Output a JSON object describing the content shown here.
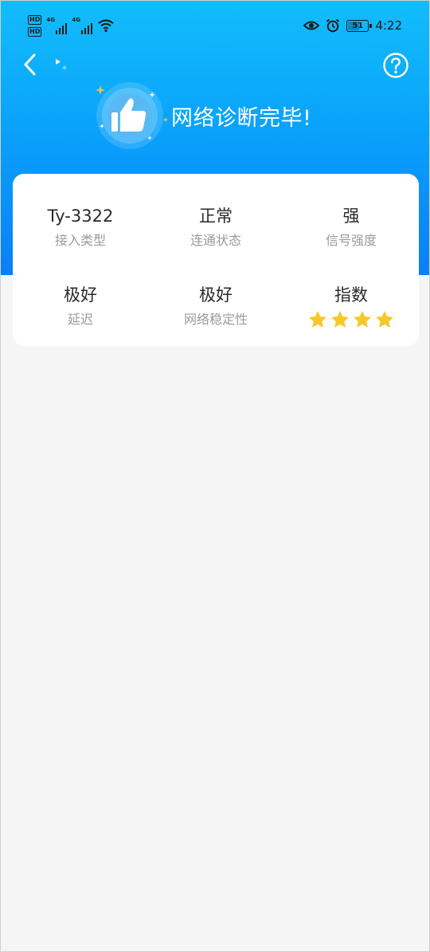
{
  "status_bar": {
    "hd1": "HD",
    "hd2": "HD",
    "sim1_net": "4G",
    "sim2_net": "4G",
    "battery_level": "51",
    "time": "4:22",
    "icons": [
      "hd-icon",
      "signal-icon",
      "wifi-icon",
      "eye-icon",
      "alarm-icon",
      "battery-icon"
    ]
  },
  "nav": {
    "back_icon": "chevron-left-icon",
    "help_icon": "help-circle-icon"
  },
  "hero": {
    "icon": "thumbs-up-icon",
    "title": "网络诊断完毕!"
  },
  "stats": {
    "items": [
      {
        "value": "Ty-3322",
        "label": "接入类型"
      },
      {
        "value": "正常",
        "label": "连通状态"
      },
      {
        "value": "强",
        "label": "信号强度"
      },
      {
        "value": "极好",
        "label": "延迟"
      },
      {
        "value": "极好",
        "label": "网络稳定性"
      },
      {
        "value": "指数",
        "label": ""
      }
    ],
    "rating": {
      "stars": 4,
      "max": 4,
      "icon": "star-icon"
    }
  },
  "colors": {
    "header_top": "#12bdfb",
    "header_bottom": "#0a7ff6",
    "star": "#f7c72b",
    "background": "#f5f5f5"
  }
}
